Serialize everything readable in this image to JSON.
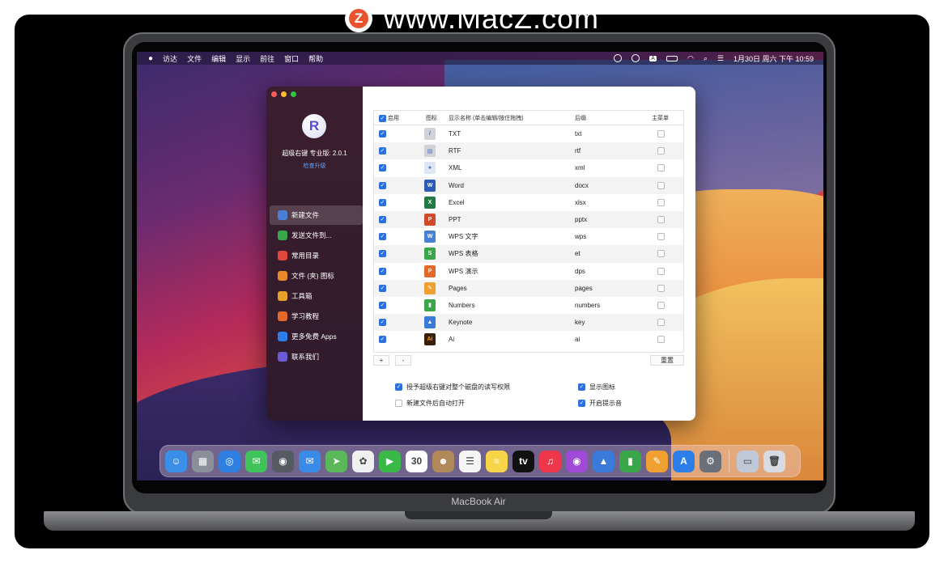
{
  "watermark": {
    "logo_letter": "Z",
    "text": "www.MacZ.com"
  },
  "laptop": {
    "brand": "MacBook Air"
  },
  "menubar": {
    "apple": "",
    "items": [
      "访达",
      "文件",
      "编辑",
      "显示",
      "前往",
      "窗口",
      "帮助"
    ],
    "clock": "1月30日 周六 下午 10:59",
    "status_icons": [
      "sync-icon",
      "play-icon",
      "text-input-icon",
      "battery-icon",
      "wifi-icon",
      "search-icon",
      "control-center-icon"
    ]
  },
  "sidebar": {
    "app_logo": "R",
    "app_name": "超级右键 专业版: 2.0.1",
    "upgrade": "检查升级",
    "items": [
      {
        "label": "新建文件",
        "icon": "new-file-icon",
        "color": "#4a7fd6",
        "active": true
      },
      {
        "label": "发送文件到...",
        "icon": "send-file-icon",
        "color": "#3aa64a"
      },
      {
        "label": "常用目录",
        "icon": "heart-icon",
        "color": "#e0473a"
      },
      {
        "label": "文件 (夹) 图标",
        "icon": "folder-icon",
        "color": "#e8892a"
      },
      {
        "label": "工具箱",
        "icon": "toolbox-icon",
        "color": "#e8a02a"
      },
      {
        "label": "学习教程",
        "icon": "book-icon",
        "color": "#e36a2a"
      },
      {
        "label": "更多免费 Apps",
        "icon": "app-store-icon",
        "color": "#2c7ee8"
      },
      {
        "label": "联系我们",
        "icon": "contact-icon",
        "color": "#6a5ad6"
      }
    ]
  },
  "table": {
    "headers": {
      "enable": "启用",
      "icon": "图标",
      "name": "显示名称 (单击编辑/按住拖拽)",
      "ext": "后缀",
      "menu": "主菜单"
    },
    "rows": [
      {
        "name": "TXT",
        "ext": "txt",
        "icon": "txt-file-icon",
        "color": "#cfd3d8",
        "glyph": "/"
      },
      {
        "name": "RTF",
        "ext": "rtf",
        "icon": "rtf-file-icon",
        "color": "#cfd3d8",
        "glyph": "▤"
      },
      {
        "name": "XML",
        "ext": "xml",
        "icon": "xml-file-icon",
        "color": "#dfe6f3",
        "glyph": "●"
      },
      {
        "name": "Word",
        "ext": "docx",
        "icon": "word-icon",
        "color": "#2b5bb8",
        "glyph": "W"
      },
      {
        "name": "Excel",
        "ext": "xlsx",
        "icon": "excel-icon",
        "color": "#1f7a43",
        "glyph": "X"
      },
      {
        "name": "PPT",
        "ext": "pptx",
        "icon": "powerpoint-icon",
        "color": "#d04a2a",
        "glyph": "P"
      },
      {
        "name": "WPS 文字",
        "ext": "wps",
        "icon": "wps-writer-icon",
        "color": "#4a7fd6",
        "glyph": "W"
      },
      {
        "name": "WPS 表格",
        "ext": "et",
        "icon": "wps-spreadsheet-icon",
        "color": "#3aa64a",
        "glyph": "S"
      },
      {
        "name": "WPS 演示",
        "ext": "dps",
        "icon": "wps-presentation-icon",
        "color": "#e36a2a",
        "glyph": "P"
      },
      {
        "name": "Pages",
        "ext": "pages",
        "icon": "pages-icon",
        "color": "#f0a030",
        "glyph": "✎"
      },
      {
        "name": "Numbers",
        "ext": "numbers",
        "icon": "numbers-icon",
        "color": "#3aa64a",
        "glyph": "▮"
      },
      {
        "name": "Keynote",
        "ext": "key",
        "icon": "keynote-icon",
        "color": "#3a7ad8",
        "glyph": "▲"
      },
      {
        "name": "Ai",
        "ext": "ai",
        "icon": "illustrator-icon",
        "color": "#3a1f08",
        "glyph": "Ai"
      }
    ]
  },
  "table_footer": {
    "add": "+",
    "remove": "-",
    "reset": "重置"
  },
  "options": {
    "grant_disk": "授予超级右键对整个磁盘的读写权限",
    "auto_open": "新建文件后自动打开",
    "show_icon": "显示图标",
    "sound": "开启提示音"
  },
  "dock": {
    "calendar_day": "30",
    "apps": [
      {
        "icon": "finder-icon",
        "color": "#3a8fe8",
        "glyph": "☺"
      },
      {
        "icon": "launchpad-icon",
        "color": "#8a8f99",
        "glyph": "▦"
      },
      {
        "icon": "safari-icon",
        "color": "#2f7fe0",
        "glyph": "◎"
      },
      {
        "icon": "messages-icon",
        "color": "#3fc35a",
        "glyph": "✉"
      },
      {
        "icon": "screenshot-icon",
        "color": "#555a63",
        "glyph": "◉"
      },
      {
        "icon": "mail-icon",
        "color": "#3a8ae8",
        "glyph": "✉"
      },
      {
        "icon": "maps-icon",
        "color": "#5bb85a",
        "glyph": "➤"
      },
      {
        "icon": "photos-icon",
        "color": "#f0f0f0",
        "glyph": "✿"
      },
      {
        "icon": "facetime-icon",
        "color": "#3ab848",
        "glyph": "▶"
      },
      {
        "icon": "calendar-icon",
        "color": "#ffffff",
        "glyph": "30"
      },
      {
        "icon": "contacts-icon",
        "color": "#b0885a",
        "glyph": "☻"
      },
      {
        "icon": "reminders-icon",
        "color": "#f5f5f5",
        "glyph": "☰"
      },
      {
        "icon": "notes-icon",
        "color": "#f8d548",
        "glyph": "≡"
      },
      {
        "icon": "apple-tv-icon",
        "color": "#111111",
        "glyph": "tv"
      },
      {
        "icon": "music-icon",
        "color": "#f0364a",
        "glyph": "♫"
      },
      {
        "icon": "podcasts-icon",
        "color": "#a048d8",
        "glyph": "◉"
      },
      {
        "icon": "keynote-dock-icon",
        "color": "#3a7ad8",
        "glyph": "▲"
      },
      {
        "icon": "numbers-dock-icon",
        "color": "#3aa64a",
        "glyph": "▮"
      },
      {
        "icon": "pages-dock-icon",
        "color": "#f0a030",
        "glyph": "✎"
      },
      {
        "icon": "app-store-dock-icon",
        "color": "#2c7ee8",
        "glyph": "A"
      },
      {
        "icon": "system-preferences-icon",
        "color": "#6a6f78",
        "glyph": "⚙"
      }
    ],
    "extras": [
      {
        "icon": "downloads-stack-icon",
        "color": "#c0c8d8",
        "glyph": "▭"
      },
      {
        "icon": "trash-icon",
        "color": "#d8dce2",
        "glyph": "🗑"
      }
    ]
  }
}
